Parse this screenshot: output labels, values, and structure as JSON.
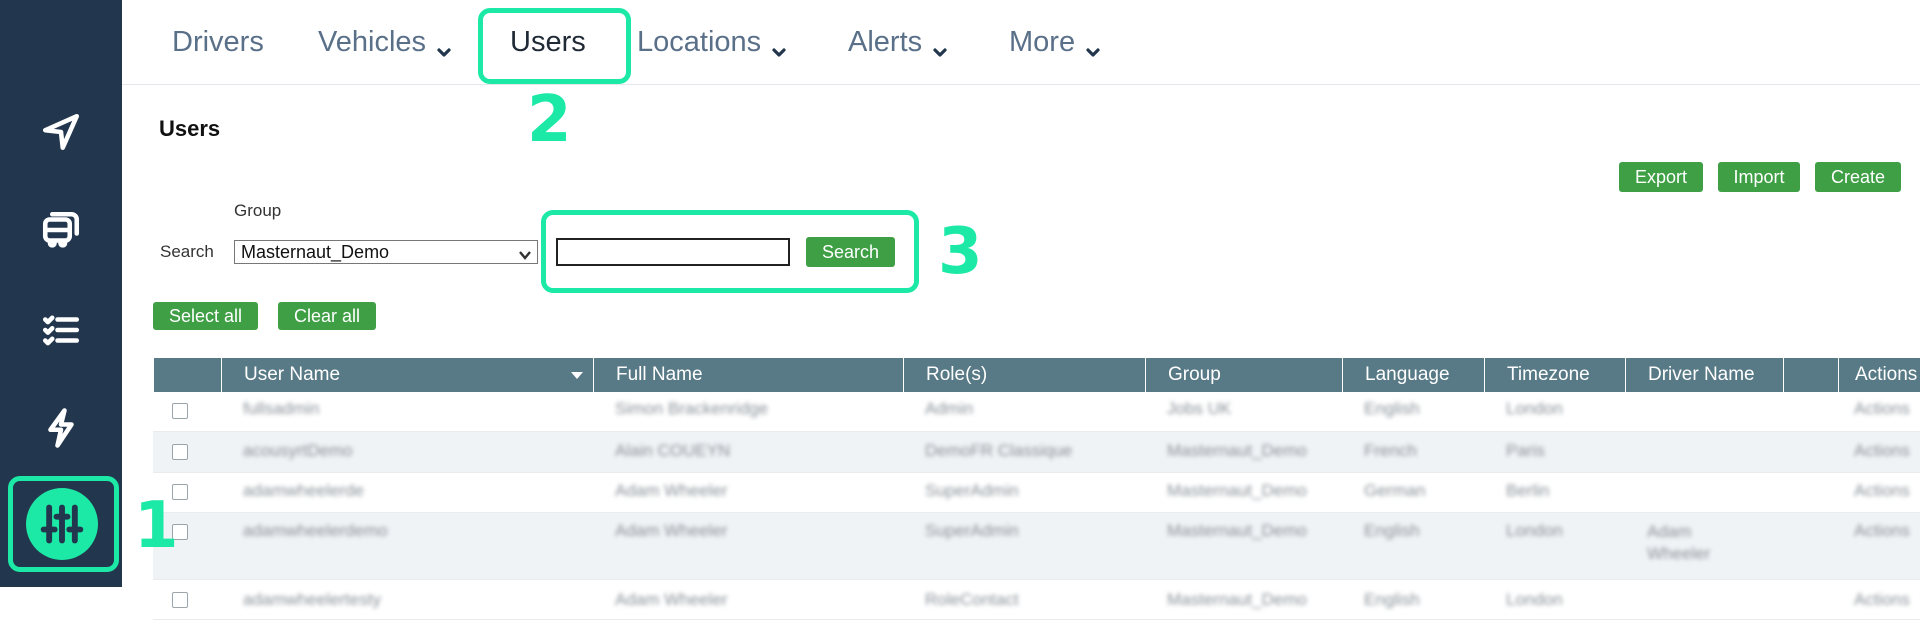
{
  "nav": {
    "items": [
      {
        "label": "Drivers",
        "dropdown": false
      },
      {
        "label": "Vehicles",
        "dropdown": true
      },
      {
        "label": "Users",
        "dropdown": false,
        "active": true
      },
      {
        "label": "Locations",
        "dropdown": true
      },
      {
        "label": "Alerts",
        "dropdown": true
      },
      {
        "label": "More",
        "dropdown": true
      }
    ]
  },
  "sidebar": {
    "icons": [
      "navigation-arrow-icon",
      "bus-icon",
      "checklist-icon",
      "lightning-icon",
      "settings-sliders-icon"
    ]
  },
  "page": {
    "title": "Users"
  },
  "toolbar": {
    "export_label": "Export",
    "import_label": "Import",
    "create_label": "Create"
  },
  "filters": {
    "group_label": "Group",
    "search_label": "Search",
    "group_value": "Masternaut_Demo",
    "search_value": "",
    "search_button": "Search",
    "select_all": "Select all",
    "clear_all": "Clear all"
  },
  "annotations": {
    "n1": "1",
    "n2": "2",
    "n3": "3"
  },
  "colors": {
    "sidebar": "#22364e",
    "accent": "#1de9a6",
    "button": "#3f9f45",
    "table_header": "#587a86"
  },
  "table": {
    "columns": [
      "",
      "User Name",
      "Full Name",
      "Role(s)",
      "Group",
      "Language",
      "Timezone",
      "Driver Name",
      "",
      "Actions"
    ],
    "rows": [
      [
        "fullsadmin",
        "Simon Brackenridge",
        "Admin",
        "Jobs UK",
        "English",
        "London",
        "",
        "Actions"
      ],
      [
        "acousyrtDemo",
        "Alain COUEYN",
        "DemoFR Classique",
        "Masternaut_Demo",
        "French",
        "Paris",
        "",
        "Actions"
      ],
      [
        "adamwheelerde",
        "Adam Wheeler",
        "SuperAdmin",
        "Masternaut_Demo",
        "German",
        "Berlin",
        "",
        "Actions"
      ],
      [
        "adamwheelerdemo",
        "Adam Wheeler",
        "SuperAdmin",
        "Masternaut_Demo",
        "English",
        "London",
        "Adam Wheeler",
        "Actions"
      ],
      [
        "adamwheelertesty",
        "Adam Wheeler",
        "RoleContact",
        "Masternaut_Demo",
        "English",
        "London",
        "",
        "Actions"
      ]
    ]
  }
}
